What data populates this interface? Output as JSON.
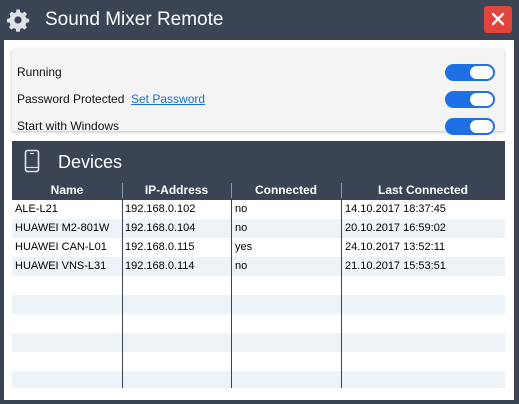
{
  "window": {
    "title": "Sound Mixer Remote",
    "icons": {
      "app": "gear-icon",
      "close": "close-icon"
    },
    "colors": {
      "titlebar": "#3a4454",
      "close": "#e0443a",
      "accent": "#1f6fe5"
    }
  },
  "settings": {
    "running": {
      "label": "Running",
      "enabled": true
    },
    "password": {
      "label": "Password Protected",
      "link": "Set Password",
      "enabled": true
    },
    "startup": {
      "label": "Start with Windows",
      "enabled": true
    }
  },
  "devices": {
    "title": "Devices",
    "icon": "smartphone-icon",
    "columns": [
      "Name",
      "IP-Address",
      "Connected",
      "Last Connected"
    ],
    "rows": [
      [
        "ALE-L21",
        "192.168.0.102",
        "no",
        "14.10.2017 18:37:45"
      ],
      [
        "HUAWEI M2-801W",
        "192.168.0.104",
        "no",
        "20.10.2017 16:59:02"
      ],
      [
        "HUAWEI CAN-L01",
        "192.168.0.115",
        "yes",
        "24.10.2017 13:52:11"
      ],
      [
        "HUAWEI VNS-L31",
        "192.168.0.114",
        "no",
        "21.10.2017 15:53:51"
      ]
    ]
  }
}
